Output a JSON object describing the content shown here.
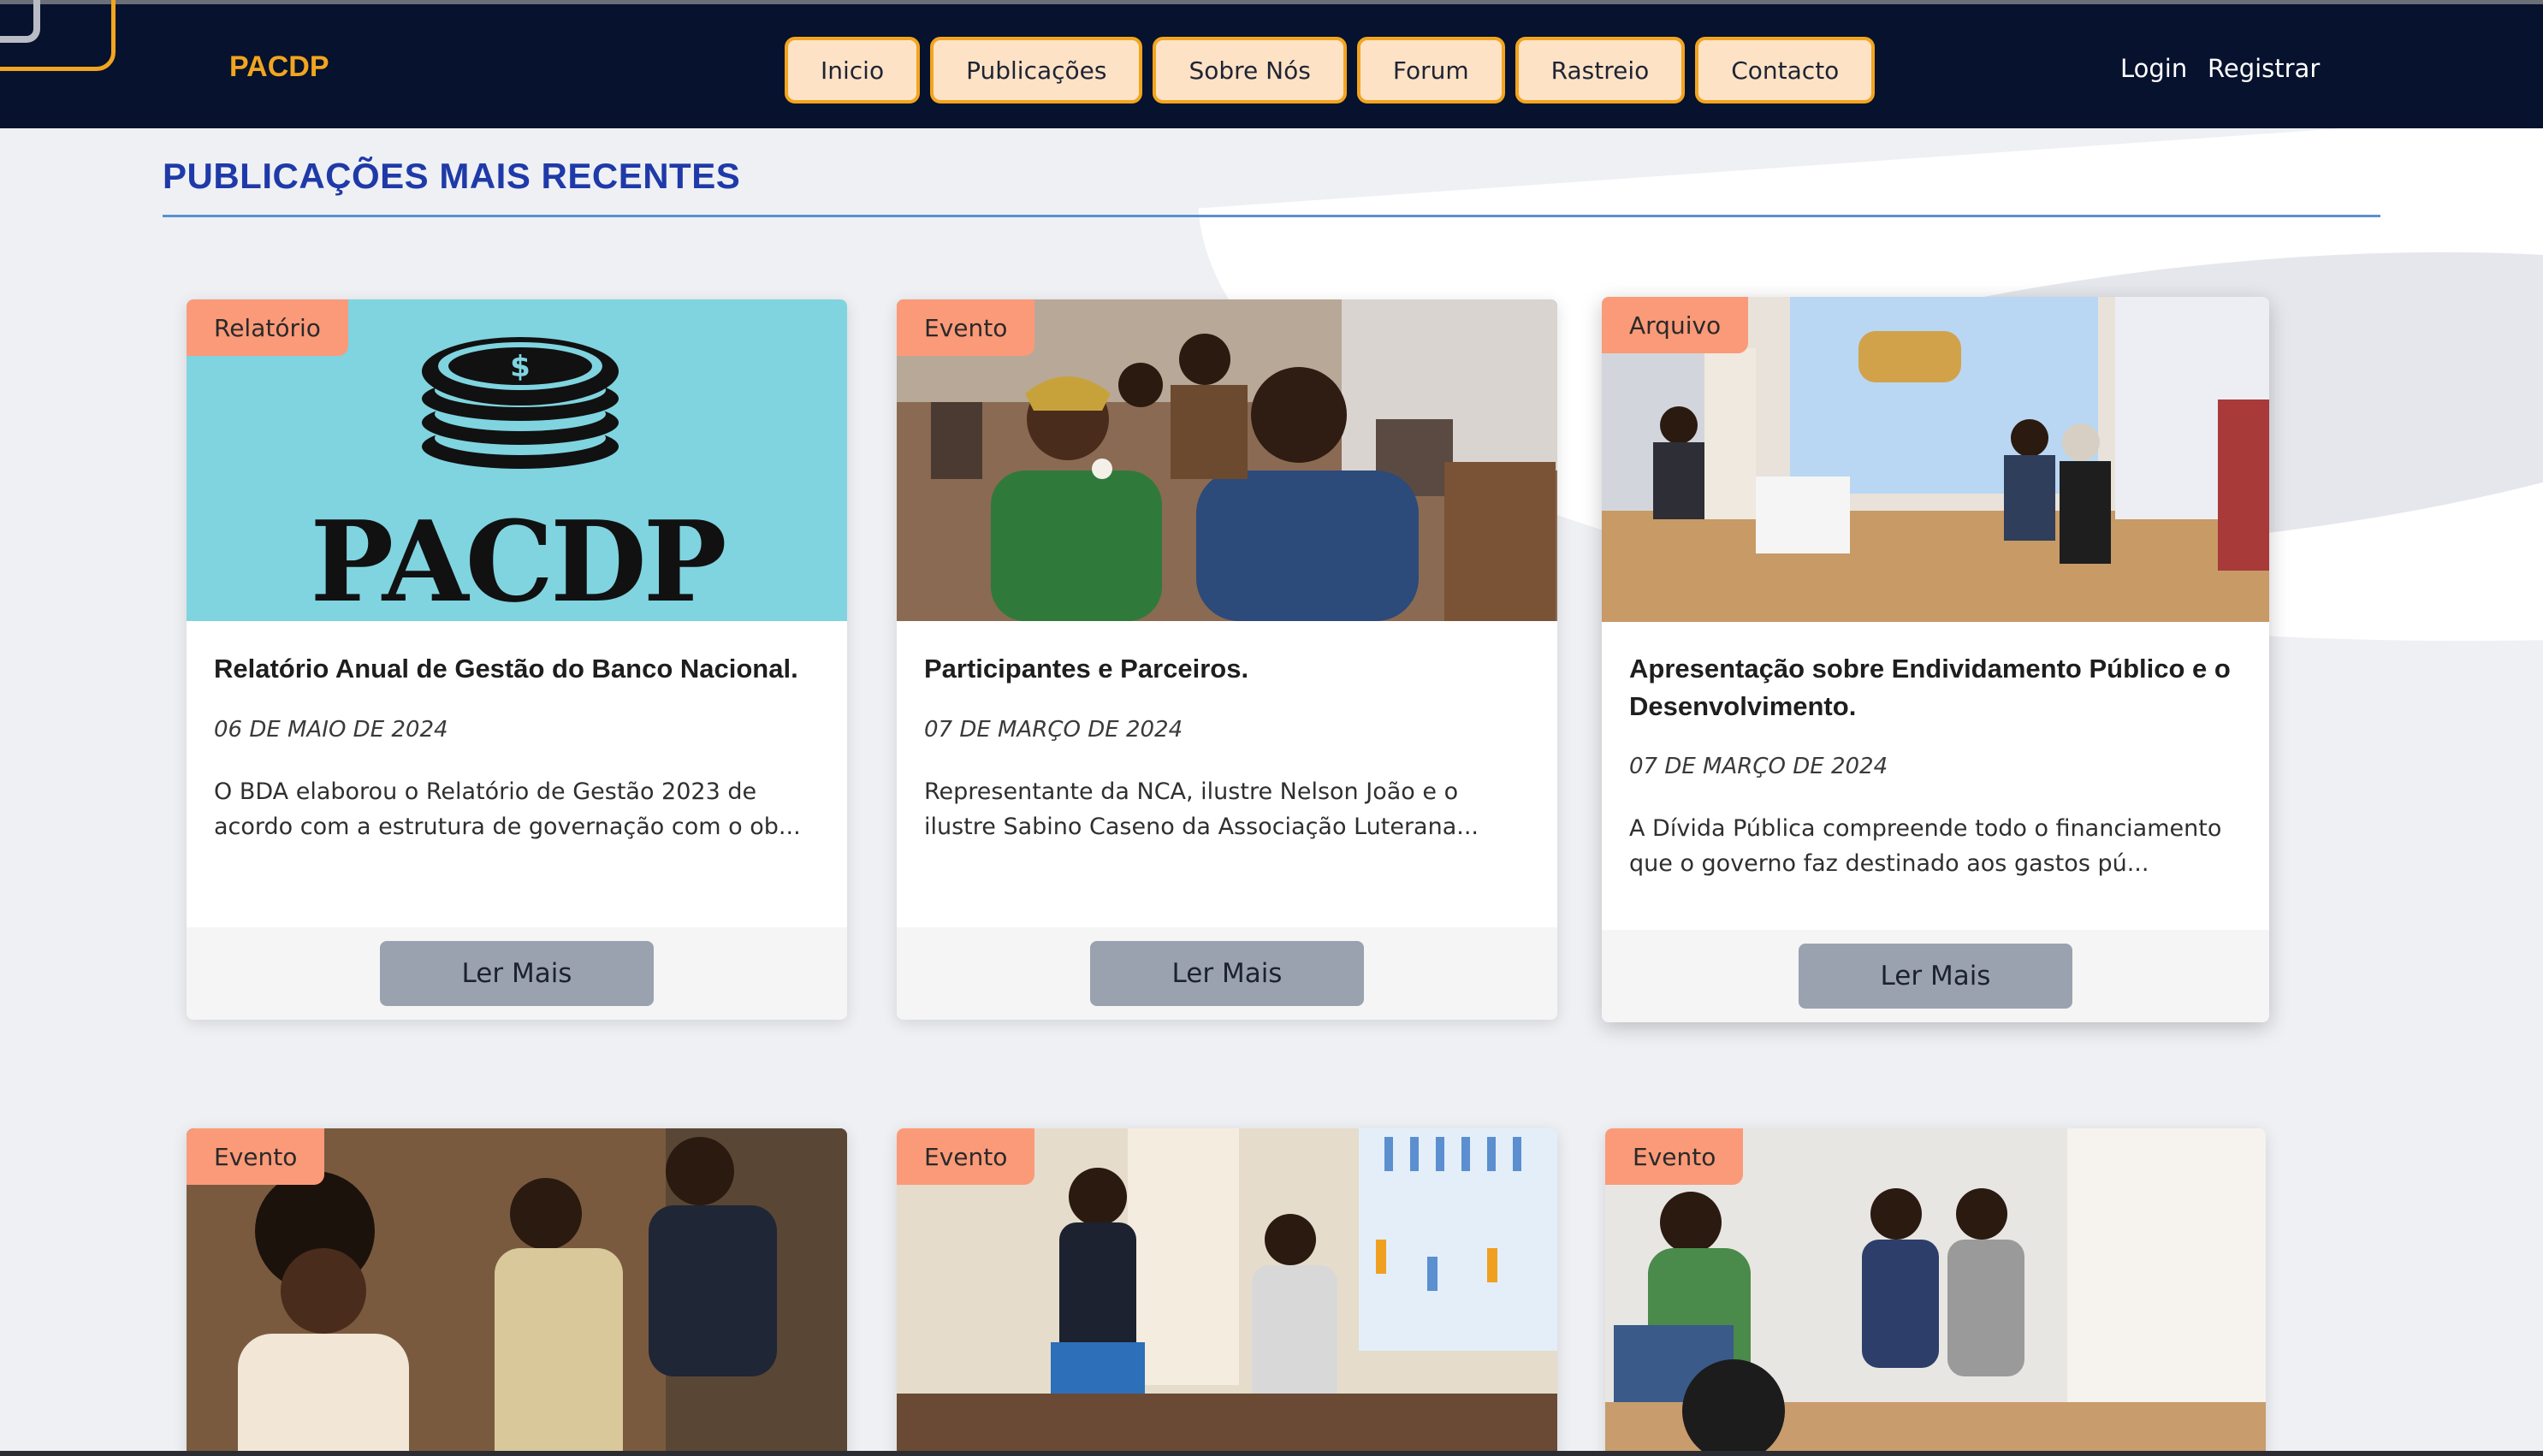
{
  "header": {
    "brand": "PACDP",
    "nav": [
      "Inicio",
      "Publicações",
      "Sobre Nós",
      "Forum",
      "Rastreio",
      "Contacto"
    ],
    "login": "Login",
    "register": "Registrar"
  },
  "section": {
    "title": "PUBLICAÇÕES MAIS RECENTES"
  },
  "cards": [
    {
      "badge": "Relatório",
      "title": "Relatório Anual de Gestão do Banco Nacional.",
      "date": "06 DE MAIO DE 2024",
      "excerpt": "O BDA elaborou o Relatório de Gestão 2023 de acordo com a estrutura de governação com o ob...",
      "button": "Ler Mais",
      "image_text": "PACDP"
    },
    {
      "badge": "Evento",
      "title": "Participantes e Parceiros.",
      "date": "07 DE MARÇO DE 2024",
      "excerpt": "Representante da NCA, ilustre Nelson João e o ilustre Sabino Caseno da Associação Luterana...",
      "button": "Ler Mais"
    },
    {
      "badge": "Arquivo",
      "title": "Apresentação sobre Endividamento Público e o Desenvolvimento.",
      "date": "07 DE MARÇO DE 2024",
      "excerpt": "A Dívida Pública compreende todo o financiamento que o governo faz destinado aos gastos pú...",
      "button": "Ler Mais"
    },
    {
      "badge": "Evento"
    },
    {
      "badge": "Evento"
    },
    {
      "badge": "Evento"
    }
  ]
}
